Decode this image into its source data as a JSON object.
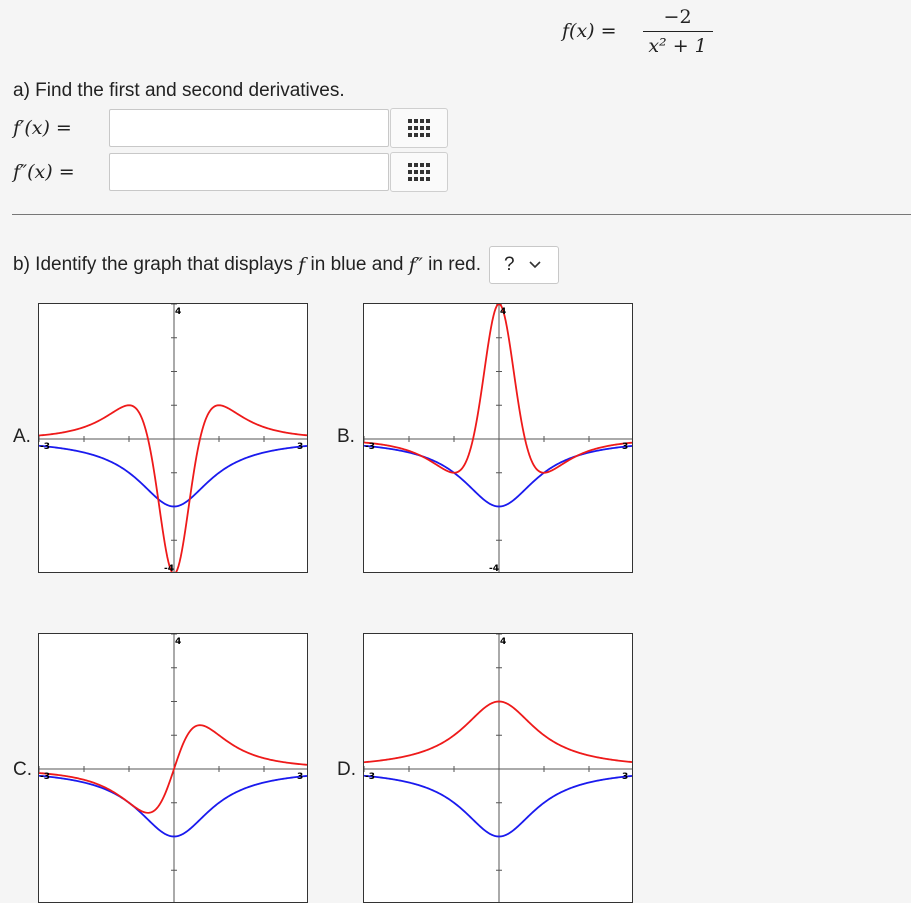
{
  "formula": {
    "lhs": "f(x) =",
    "numerator": "−2",
    "denominator": "x² + 1"
  },
  "part_a": {
    "prompt": "a) Find the first and second derivatives.",
    "rows": [
      {
        "label": "f′(x) =",
        "value": "",
        "button_icon": "matrix-grid-icon"
      },
      {
        "label": "f″(x) =",
        "value": "",
        "button_icon": "matrix-grid-icon"
      }
    ]
  },
  "part_b": {
    "prompt_prefix": "b) Identify the graph that displays ",
    "f_symbol": "f",
    "prompt_middle": " in blue and ",
    "f2_symbol": "f″",
    "prompt_suffix": " in red.",
    "select_value": "?"
  },
  "colors": {
    "blue": "#1a1aee",
    "red": "#ee1a1a"
  },
  "graphs": [
    {
      "label": "A.",
      "ytop": "4",
      "ybottom": "-4",
      "xleft": "-3",
      "xright": "3"
    },
    {
      "label": "B.",
      "ytop": "4",
      "ybottom": "-4",
      "xleft": "-3",
      "xright": "3"
    },
    {
      "label": "C.",
      "ytop": "4",
      "ybottom": "",
      "xleft": "-3",
      "xright": "3"
    },
    {
      "label": "D.",
      "ytop": "4",
      "ybottom": "",
      "xleft": "-3",
      "xright": "3"
    }
  ]
}
